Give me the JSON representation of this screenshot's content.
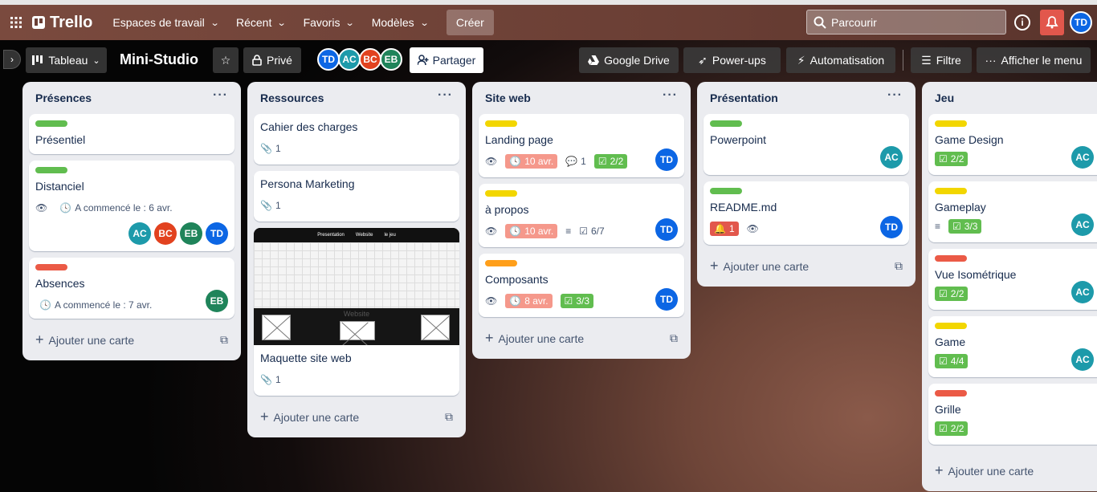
{
  "header": {
    "logo": "Trello",
    "nav": [
      "Espaces de travail",
      "Récent",
      "Favoris",
      "Modèles"
    ],
    "create": "Créer",
    "search_placeholder": "Parcourir",
    "user": "TD"
  },
  "board": {
    "view": "Tableau",
    "title": "Mini-Studio",
    "visibility": "Privé",
    "members": [
      "TD",
      "AC",
      "BC",
      "EB"
    ],
    "share": "Partager",
    "drive": "Google Drive",
    "powerups": "Power-ups",
    "automation": "Automatisation",
    "filter": "Filtre",
    "menu": "Afficher le menu"
  },
  "add_card": "Ajouter une carte",
  "lists": [
    {
      "title": "Présences",
      "cards": [
        {
          "label": "green",
          "title": "Présentiel"
        },
        {
          "label": "green",
          "title": "Distanciel",
          "started": "A commencé le : 6 avr.",
          "members": [
            "AC",
            "BC",
            "EB",
            "TD"
          ]
        },
        {
          "label": "red",
          "title": "Absences",
          "started": "A commencé le : 7 avr.",
          "members": [
            "EB"
          ]
        }
      ]
    },
    {
      "title": "Ressources",
      "cards": [
        {
          "title": "Cahier des charges",
          "attachments": "1"
        },
        {
          "title": "Persona Marketing",
          "attachments": "1"
        },
        {
          "title": "Maquette site web",
          "attachments": "1",
          "cover": {
            "nav": [
              "Presentation",
              "Website",
              "le jeu"
            ],
            "heading": "Website"
          }
        }
      ]
    },
    {
      "title": "Site web",
      "cards": [
        {
          "label": "yellow",
          "title": "Landing page",
          "due": "10 avr.",
          "comments": "1",
          "checklist": "2/2",
          "member": "TD"
        },
        {
          "label": "yellow",
          "title": "à propos",
          "due": "10 avr.",
          "checklist": "6/7",
          "member": "TD"
        },
        {
          "label": "orange",
          "title": "Composants",
          "due": "8 avr.",
          "checklist": "3/3",
          "member": "TD"
        }
      ]
    },
    {
      "title": "Présentation",
      "cards": [
        {
          "label": "green",
          "title": "Powerpoint",
          "member": "AC"
        },
        {
          "label": "green",
          "title": "README.md",
          "notifications": "1",
          "member": "TD"
        }
      ]
    },
    {
      "title": "Jeu",
      "cards": [
        {
          "label": "yellow",
          "title": "Game Design",
          "checklist": "2/2",
          "member": "AC"
        },
        {
          "label": "yellow",
          "title": "Gameplay",
          "checklist": "3/3",
          "member": "AC"
        },
        {
          "label": "red",
          "title": "Vue Isométrique",
          "checklist": "2/2",
          "member": "AC"
        },
        {
          "label": "yellow",
          "title": "Game",
          "checklist": "4/4",
          "member": "AC"
        },
        {
          "label": "red",
          "title": "Grille",
          "checklist": "2/2"
        }
      ]
    }
  ],
  "colors": {
    "green": "#61bd4f",
    "yellow": "#f2d600",
    "red": "#eb5a46",
    "orange": "#ff9f1a",
    "TD": "#0c66e4",
    "AC": "#1d9aaa",
    "BC": "#e2421f",
    "EB": "#1f845a"
  }
}
